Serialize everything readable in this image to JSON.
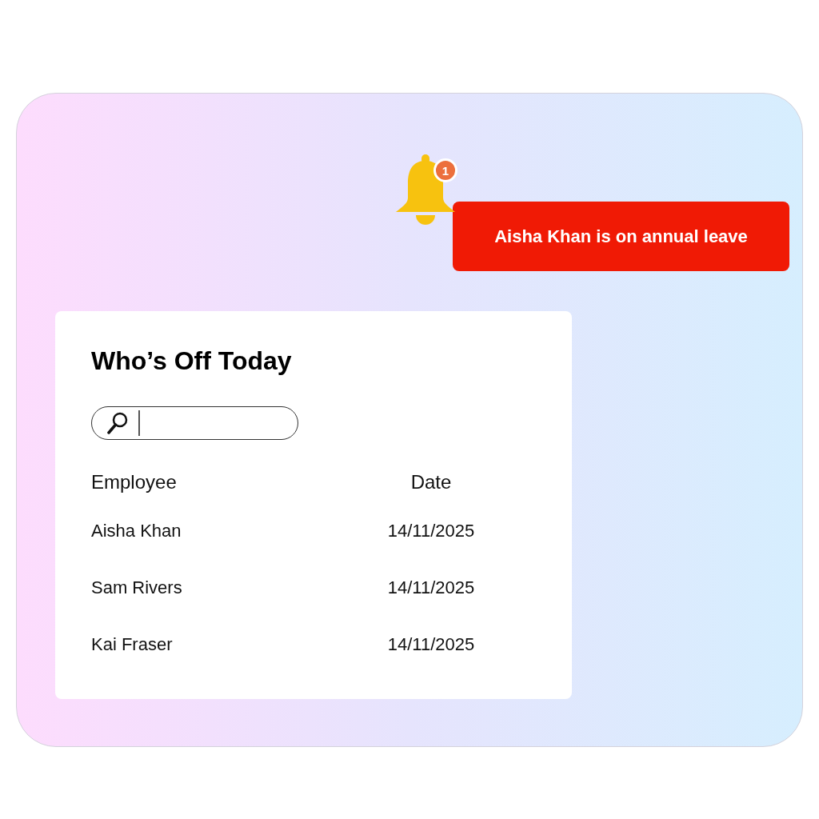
{
  "notification": {
    "count": "1",
    "message": "Aisha Khan is on annual leave"
  },
  "card": {
    "title": "Who’s Off Today",
    "search": {
      "focused": true
    },
    "table": {
      "columns": [
        "Employee",
        "Date"
      ],
      "rows": [
        {
          "employee": "Aisha Khan",
          "date": "14/11/2025"
        },
        {
          "employee": "Sam Rivers",
          "date": "14/11/2025"
        },
        {
          "employee": "Kai Fraser",
          "date": "14/11/2025"
        }
      ]
    }
  }
}
